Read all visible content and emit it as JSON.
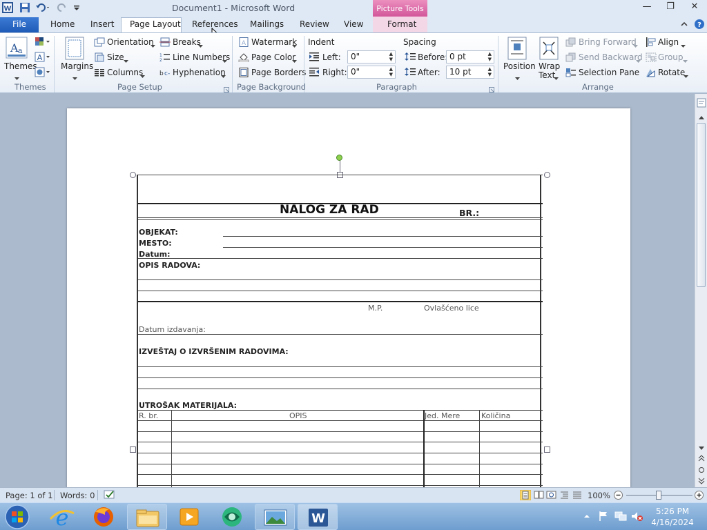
{
  "window": {
    "title": "Document1  -  Microsoft Word",
    "contextual_label": "Picture Tools"
  },
  "tabs": {
    "file": "File",
    "home": "Home",
    "insert": "Insert",
    "page_layout": "Page Layout",
    "references": "References",
    "mailings": "Mailings",
    "review": "Review",
    "view": "View",
    "format": "Format"
  },
  "ribbon": {
    "themes": {
      "themes_label": "Themes",
      "group_label": "Themes"
    },
    "page_setup": {
      "margins": "Margins",
      "orientation": "Orientation",
      "size": "Size",
      "columns": "Columns",
      "breaks": "Breaks",
      "line_numbers": "Line Numbers",
      "hyphenation": "Hyphenation",
      "group_label": "Page Setup"
    },
    "page_background": {
      "watermark": "Watermark",
      "page_color": "Page Color",
      "page_borders": "Page Borders",
      "group_label": "Page Background"
    },
    "paragraph": {
      "indent_label": "Indent",
      "left_label": "Left:",
      "left_value": "0\"",
      "right_label": "Right:",
      "right_value": "0\"",
      "spacing_label": "Spacing",
      "before_label": "Before:",
      "before_value": "0 pt",
      "after_label": "After:",
      "after_value": "10 pt",
      "group_label": "Paragraph"
    },
    "arrange": {
      "position": "Position",
      "wrap_text_line1": "Wrap",
      "wrap_text_line2": "Text",
      "bring_forward": "Bring Forward",
      "send_backward": "Send Backward",
      "selection_pane": "Selection Pane",
      "align": "Align",
      "group": "Group",
      "rotate": "Rotate",
      "group_label": "Arrange"
    }
  },
  "document": {
    "form_title": "NALOG ZA RAD",
    "br_label": "BR.:",
    "objekat": "OBJEKAT:",
    "mesto": "MESTO:",
    "datum": "Datum:",
    "opis_radova": "OPIS RADOVA:",
    "mp": "M.P.",
    "ovlasceno_lice": "Ovlašćeno lice",
    "datum_izdavanja": "Datum izdavanja:",
    "izvestaj": "IZVEŠTAJ O IZVRŠENIM RADOVIMA:",
    "utrosak": "UTROŠAK MATERIJALA:",
    "table_headers": [
      "R. br.",
      "OPIS",
      "Jed. Mere",
      "Količina"
    ]
  },
  "status": {
    "page": "Page: 1 of 1",
    "words": "Words: 0",
    "zoom": "100%"
  },
  "taskbar": {
    "time": "5:26 PM",
    "date": "4/16/2024"
  }
}
